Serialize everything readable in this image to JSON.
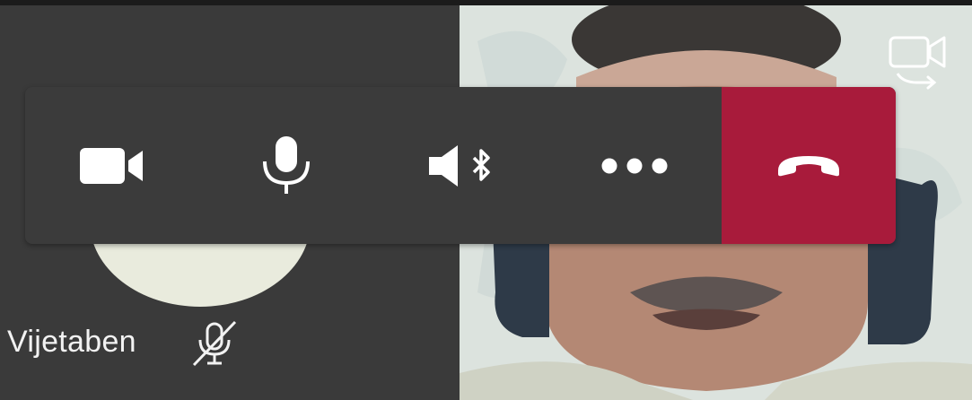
{
  "participant": {
    "name": "Vijetaben",
    "mic_state": "muted",
    "avatar_color": "#e9ebdd"
  },
  "controls": [
    {
      "id": "video",
      "icon": "video-camera-icon"
    },
    {
      "id": "mic",
      "icon": "microphone-icon"
    },
    {
      "id": "audio_output",
      "icon": "speaker-bluetooth-icon"
    },
    {
      "id": "more",
      "icon": "more-options-icon"
    },
    {
      "id": "hangup",
      "icon": "hang-up-icon",
      "color": "#a81b3b"
    }
  ],
  "remote_video": {
    "switch_camera_icon": "switch-camera-icon"
  },
  "colors": {
    "background": "#2b2b2b",
    "control_bar": "#3b3b3b",
    "hangup": "#a81b3b",
    "icon": "#ffffff"
  }
}
